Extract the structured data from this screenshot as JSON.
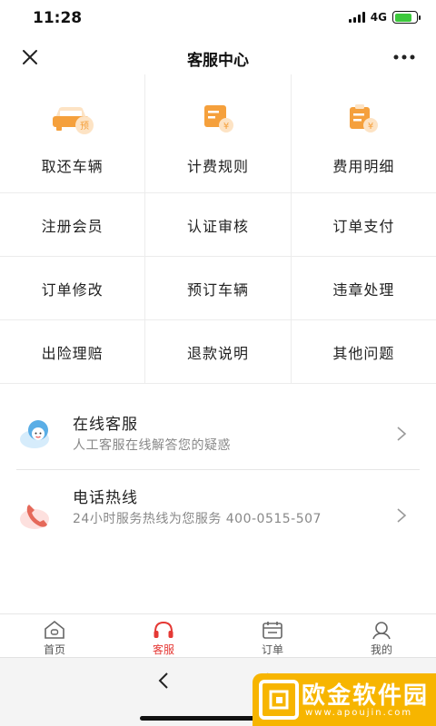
{
  "status": {
    "time": "11:28",
    "network": "4G",
    "battery_level": 0.8,
    "battery_color": "#3cc83c"
  },
  "nav": {
    "title": "客服中心"
  },
  "grid": {
    "icon_row": [
      {
        "label": "取还车辆",
        "icon": "car-reservation-icon"
      },
      {
        "label": "计费规则",
        "icon": "billing-rules-icon"
      },
      {
        "label": "费用明细",
        "icon": "fee-details-icon"
      }
    ],
    "rows": [
      [
        "注册会员",
        "认证审核",
        "订单支付"
      ],
      [
        "订单修改",
        "预订车辆",
        "违章处理"
      ],
      [
        "出险理赔",
        "退款说明",
        "其他问题"
      ]
    ]
  },
  "services": [
    {
      "title": "在线客服",
      "desc": "人工客服在线解答您的疑惑",
      "icon": "customer-service-avatar-icon"
    },
    {
      "title": "电话热线",
      "desc": "24小时服务热线为您服务 400-0515-507",
      "icon": "phone-icon"
    }
  ],
  "tabs": [
    {
      "label": "首页",
      "icon": "home-icon",
      "active": false
    },
    {
      "label": "客服",
      "icon": "headset-icon",
      "active": true
    },
    {
      "label": "订单",
      "icon": "calendar-icon",
      "active": false
    },
    {
      "label": "我的",
      "icon": "user-icon",
      "active": false
    }
  ],
  "watermark": {
    "title": "欧金软件园",
    "url": "www.apoujin.com"
  },
  "colors": {
    "accent": "#e53935",
    "icon_orange": "#f5a03c",
    "icon_light": "#fde3c4"
  }
}
